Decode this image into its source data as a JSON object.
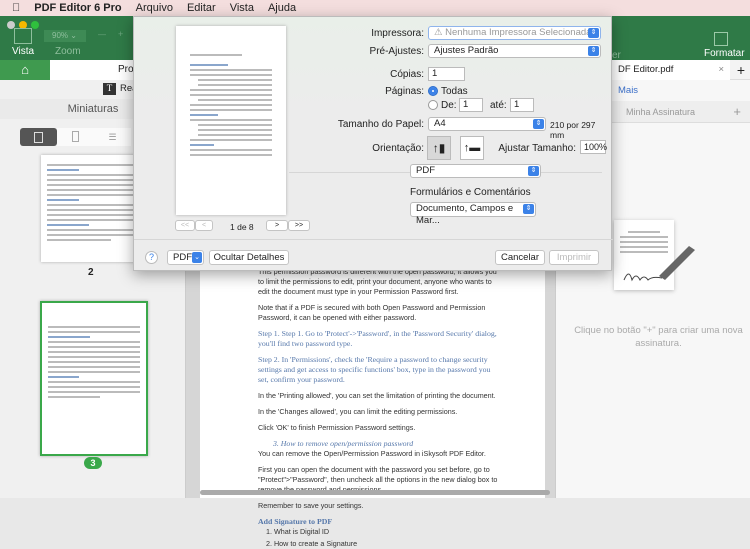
{
  "menubar": {
    "apple": "",
    "app": "PDF Editor 6 Pro",
    "items": [
      "Arquivo",
      "Editar",
      "Vista",
      "Ajuda"
    ]
  },
  "toolbar": {
    "view": "Vista",
    "zoom_label": "Zoom",
    "zoom_value": "90%",
    "minus": "—",
    "plus": "+",
    "format": "Formatar",
    "partial": "er"
  },
  "tabs": {
    "home_icon": "home-icon",
    "doc_tab_left": "Proc",
    "doc_tab_right": "DF Editor.pdf",
    "close": "×",
    "add": "+"
  },
  "subbar": {
    "text_tool": "T",
    "text_label": "Rea",
    "more": "Mais"
  },
  "sidebar": {
    "title": "Miniaturas",
    "thumbnails": [
      {
        "label": "2",
        "selected": false
      },
      {
        "label": "3",
        "selected": true
      }
    ]
  },
  "right_panel": {
    "section": "Minha Assinatura",
    "add": "+",
    "empty_text": "Clique no botão \"+\" para criar uma nova assinatura."
  },
  "document": {
    "paragraphs": [
      {
        "style": "body",
        "text": "This permission password is different with the open password, it allows you to limit the permissions to edit, print your document, anyone who wants to edit the document must type in your Permission Password first."
      },
      {
        "style": "body",
        "text": "Note that if a PDF is secured with both Open Password and Permission Password, it can be opened with either password."
      },
      {
        "style": "heading",
        "text": "Step 1. Step 1. Go to 'Protect'->'Password', in the 'Password Security' dialog, you'll find two password type."
      },
      {
        "style": "heading",
        "text": "Step 2. In 'Permissions', check the 'Require a password to change security settings and get access to specific functions' box, type in the password you set, confirm your password."
      },
      {
        "style": "body",
        "text": "In the 'Printing allowed', you can set the limitation of printing the document."
      },
      {
        "style": "body",
        "text": "In the 'Changes allowed', you can limit the editing permissions."
      },
      {
        "style": "body",
        "text": "Click 'OK' to finish Permission Password settings."
      },
      {
        "style": "heading-italic",
        "text": "3.        How to remove open/permission password"
      },
      {
        "style": "body",
        "text": "You can remove the Open/Permission Password in iSkysoft PDF Editor."
      },
      {
        "style": "body",
        "text": "First you can open the document with the password you set before, go to \"Protect\">\"Password\", then uncheck all the options in the new dialog box to remove the password and permissions."
      },
      {
        "style": "body",
        "text": "Remember to save your settings."
      },
      {
        "style": "heading-bold",
        "text": "Add Signature to PDF"
      },
      {
        "style": "list",
        "text": "1.   What is Digital ID"
      },
      {
        "style": "list",
        "text": "2.   How to create a Signature"
      }
    ]
  },
  "print_dialog": {
    "printer_label": "Impressora:",
    "printer_value": "⚠ Nenhuma Impressora Selecionada",
    "presets_label": "Pré-Ajustes:",
    "presets_value": "Ajustes Padrão",
    "copies_label": "Cópias:",
    "copies_value": "1",
    "pages_label": "Páginas:",
    "pages_all": "Todas",
    "pages_all_selected": true,
    "pages_from": "De:",
    "from_value": "1",
    "pages_to": "até:",
    "to_value": "1",
    "paper_label": "Tamanho do Papel:",
    "paper_value": "A4",
    "paper_dims": "210 por 297 mm",
    "orientation_label": "Orientação:",
    "orientation_selected": "portrait",
    "scale_label": "Ajustar Tamanho:",
    "scale_value": "100%",
    "section_value": "PDF",
    "forms_label": "Formulários e Comentários",
    "forms_value": "Documento, Campos e Mar...",
    "preview_nav": {
      "first": "<<",
      "prev": "<",
      "page": "1 de 8",
      "next": ">",
      "last": ">>"
    },
    "help": "?",
    "pdf_button": "PDF",
    "hide_details": "Ocultar Detalhes",
    "cancel": "Cancelar",
    "print": "Imprimir"
  },
  "colors": {
    "toolbar_green": "#2f7a47",
    "accent_blue": "#3b82e8",
    "selected_thumb": "#3aa84a"
  }
}
